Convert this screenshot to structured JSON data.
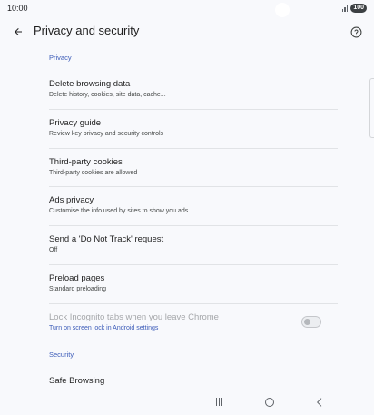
{
  "status_bar": {
    "time": "10:00",
    "battery": "100"
  },
  "app_bar": {
    "title": "Privacy and security"
  },
  "sections": {
    "privacy": {
      "label": "Privacy"
    },
    "security": {
      "label": "Security"
    }
  },
  "rows": [
    {
      "title": "Delete browsing data",
      "subtitle": "Delete history, cookies, site data, cache..."
    },
    {
      "title": "Privacy guide",
      "subtitle": "Review key privacy and security controls"
    },
    {
      "title": "Third-party cookies",
      "subtitle": "Third-party cookies are allowed"
    },
    {
      "title": "Ads privacy",
      "subtitle": "Customise the info used by sites to show you ads"
    },
    {
      "title": "Send a 'Do Not Track' request",
      "subtitle": "Off"
    },
    {
      "title": "Preload pages",
      "subtitle": "Standard preloading"
    },
    {
      "title": "Lock Incognito tabs when you leave Chrome",
      "subtitle": "Turn on screen lock in Android settings",
      "toggle_on": false,
      "enabled": false
    },
    {
      "title": "Safe Browsing",
      "subtitle": ""
    }
  ],
  "colors": {
    "accent": "#3b5bb8",
    "background": "#f8f9fc"
  },
  "icons": {
    "back": "arrow-left",
    "help": "help-circle",
    "nav_recents": "recents",
    "nav_home": "home",
    "nav_back": "back"
  }
}
